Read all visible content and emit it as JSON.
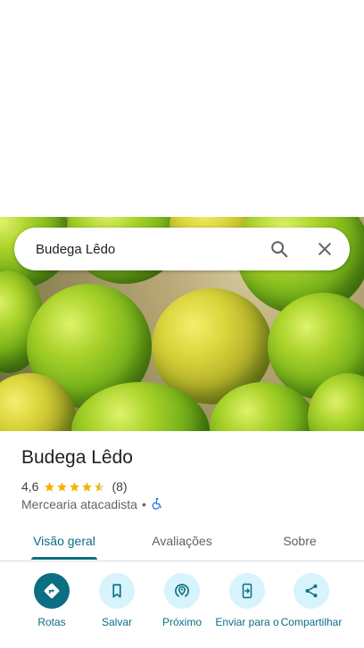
{
  "search": {
    "query": "Budega Lêdo"
  },
  "place": {
    "name": "Budega Lêdo",
    "rating": "4,6",
    "rating_value": 4.6,
    "review_count": "(8)",
    "category": "Mercearia atacadista",
    "separator": "•"
  },
  "tabs": [
    {
      "label": "Visão geral",
      "active": true
    },
    {
      "label": "Avaliações",
      "active": false
    },
    {
      "label": "Sobre",
      "active": false
    }
  ],
  "actions": [
    {
      "label": "Rotas",
      "icon": "directions-icon"
    },
    {
      "label": "Salvar",
      "icon": "bookmark-icon"
    },
    {
      "label": "Próximo",
      "icon": "nearby-icon"
    },
    {
      "label": "Enviar para o",
      "icon": "send-to-phone-icon"
    },
    {
      "label": "Compartilhar",
      "icon": "share-icon"
    }
  ],
  "colors": {
    "accent": "#0b6e83",
    "action_bg": "#d7f3fb",
    "star": "#f5b301",
    "accessibility": "#1a73e8"
  }
}
